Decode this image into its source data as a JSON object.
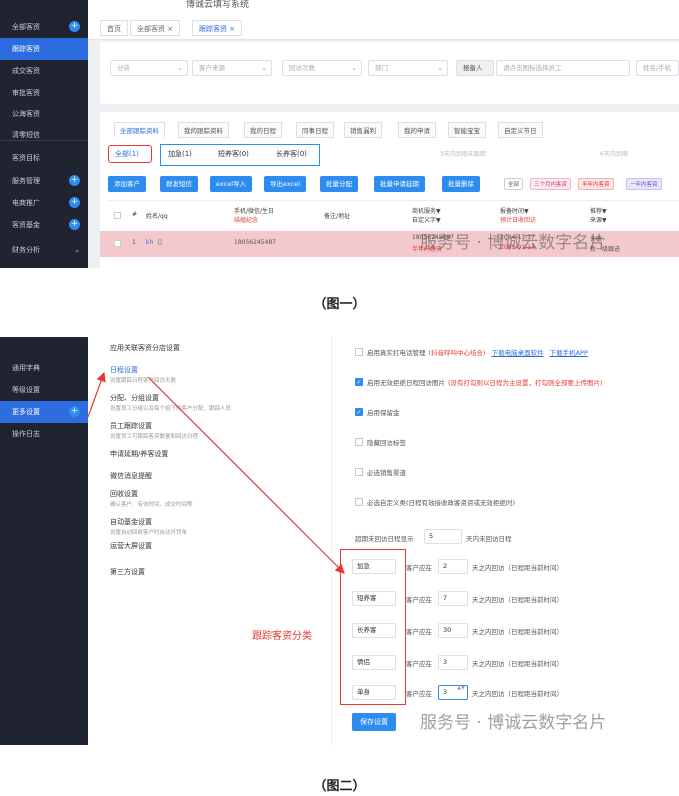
{
  "fig1": {
    "title": "博诚云填写系统",
    "sidebar": [
      {
        "label": "全部客资",
        "plus": true
      },
      {
        "label": "跟踪客资",
        "active": true
      },
      {
        "label": "成交客资"
      },
      {
        "label": "审批客资"
      },
      {
        "label": "公海客资"
      },
      {
        "label": "清零短信"
      },
      {
        "label": "客资目标"
      },
      {
        "label": "服务管理",
        "plus": true
      },
      {
        "label": "电商推广",
        "plus": true
      },
      {
        "label": "客资基金",
        "plus": true
      },
      {
        "label": "财务分析"
      }
    ],
    "page_tabs": [
      "首页",
      "全部客资 ×",
      "跟踪客资 ×"
    ],
    "filters": [
      "分店",
      "客户来源",
      "回访次数",
      "部门",
      "报备人",
      "请点击图标选择员工",
      "姓名/手机"
    ],
    "sub_tabs": [
      "全部跟踪资料",
      "我的跟踪资料",
      "我的日程",
      "同事日程",
      "销售漏判",
      "我的申请",
      "智能宝宝",
      "自定义节日"
    ],
    "categories": {
      "all": "全部(1)",
      "urgent": "加急(1)",
      "short": "短养客(0)",
      "long": "长养客(0)",
      "more": [
        "3天内到期未跟踪",
        "6天内到期"
      ]
    },
    "buttons": [
      "添加客户",
      "群发短信",
      "excel导入",
      "导出excel",
      "批量分配",
      "批量申请延期",
      "批量删除"
    ],
    "tags": [
      "全部",
      "三个月内客资",
      "半年内客资",
      "一年内客资"
    ],
    "table_headers": {
      "num": "#",
      "name": "姓名/qq",
      "phone": "手机/微信/生日",
      "phone_sub": "结婚纪念",
      "note": "备注/地址",
      "service": "商机服务▼",
      "service_sub": "自定义字▼",
      "time": "报备时间▼",
      "time_sub": "预计日收回访",
      "reco": "推荐▼",
      "reco_sub": "来源▼"
    },
    "row": {
      "index": "1",
      "name": "kh",
      "phone": "18056245487",
      "service": "18056245487",
      "service_sub": "半年内客资",
      "time": "2024-11-17",
      "time_sub": "2025-01-13",
      "reco": "外联",
      "reco_sub": "新一级跟进"
    }
  },
  "caption1": "（图一）",
  "fig2": {
    "sidebar": [
      {
        "label": "通用字典"
      },
      {
        "label": "等级设置"
      },
      {
        "label": "更多设置",
        "active": true,
        "plus": true
      },
      {
        "label": "操作日志"
      }
    ],
    "menu": [
      {
        "title": "应用关联客资分店设置",
        "sub": ""
      },
      {
        "title": "日程设置",
        "sub": "设置跟踪日程客户回访天数"
      },
      {
        "title": "分配、分组设置",
        "sub": "设置员工分组以及每个组下的客户分配、跟踪人员"
      },
      {
        "title": "员工跟踪设置",
        "sub": "设置员工可跟踪客资数量和回访日程"
      },
      {
        "title": "申请延期/养客设置",
        "sub": ""
      },
      {
        "title": "微信消息提醒",
        "sub": ""
      },
      {
        "title": "回收设置",
        "sub": "确认客户、有效时间、成交时间等"
      },
      {
        "title": "自动基金设置",
        "sub": "设置自动回收客户时自动开罚单"
      },
      {
        "title": "运营大屏设置",
        "sub": ""
      },
      {
        "title": "第三方设置",
        "sub": ""
      }
    ],
    "options": [
      {
        "text": "启用真实打电话管理",
        "note": "(抖音呼叫中心结合)",
        "links": [
          "下载电脑桌面软件",
          "下载手机APP"
        ],
        "on": false
      },
      {
        "text": "启用无效拒绝日程回访图片",
        "note": "(没有打勾则以日程为主设置，打勾则全部要上传图片)",
        "on": true
      },
      {
        "text": "启用保留金",
        "on": true
      },
      {
        "text": "隐藏回访标签",
        "on": false
      },
      {
        "text": "必选销售渠道",
        "on": false
      },
      {
        "text": "必选自定义类(日程有效接收政客资资或无效拒绝时)",
        "on": false
      }
    ],
    "overdue": {
      "prefix": "超期未回访日程显示",
      "value": "5",
      "suffix": "天内未回访日程"
    },
    "levels": [
      {
        "name": "加急",
        "days": "2"
      },
      {
        "name": "短养客",
        "days": "7"
      },
      {
        "name": "长养客",
        "days": "30"
      },
      {
        "name": "情侣",
        "days": "3"
      },
      {
        "name": "单身",
        "days": "3"
      }
    ],
    "level_prefix": "客户应在",
    "level_suffix": "天之内回访（日程距当前时间）",
    "save": "保存设置",
    "annotation": "跟踪客资分类"
  },
  "caption2": "（图二）",
  "watermark": "服务号 · 博诚云数字名片",
  "colors": {
    "sidebar": "#1f2430",
    "accent": "#2d8cf0",
    "annotation": "#e53935",
    "row": "#f3c9ce"
  }
}
